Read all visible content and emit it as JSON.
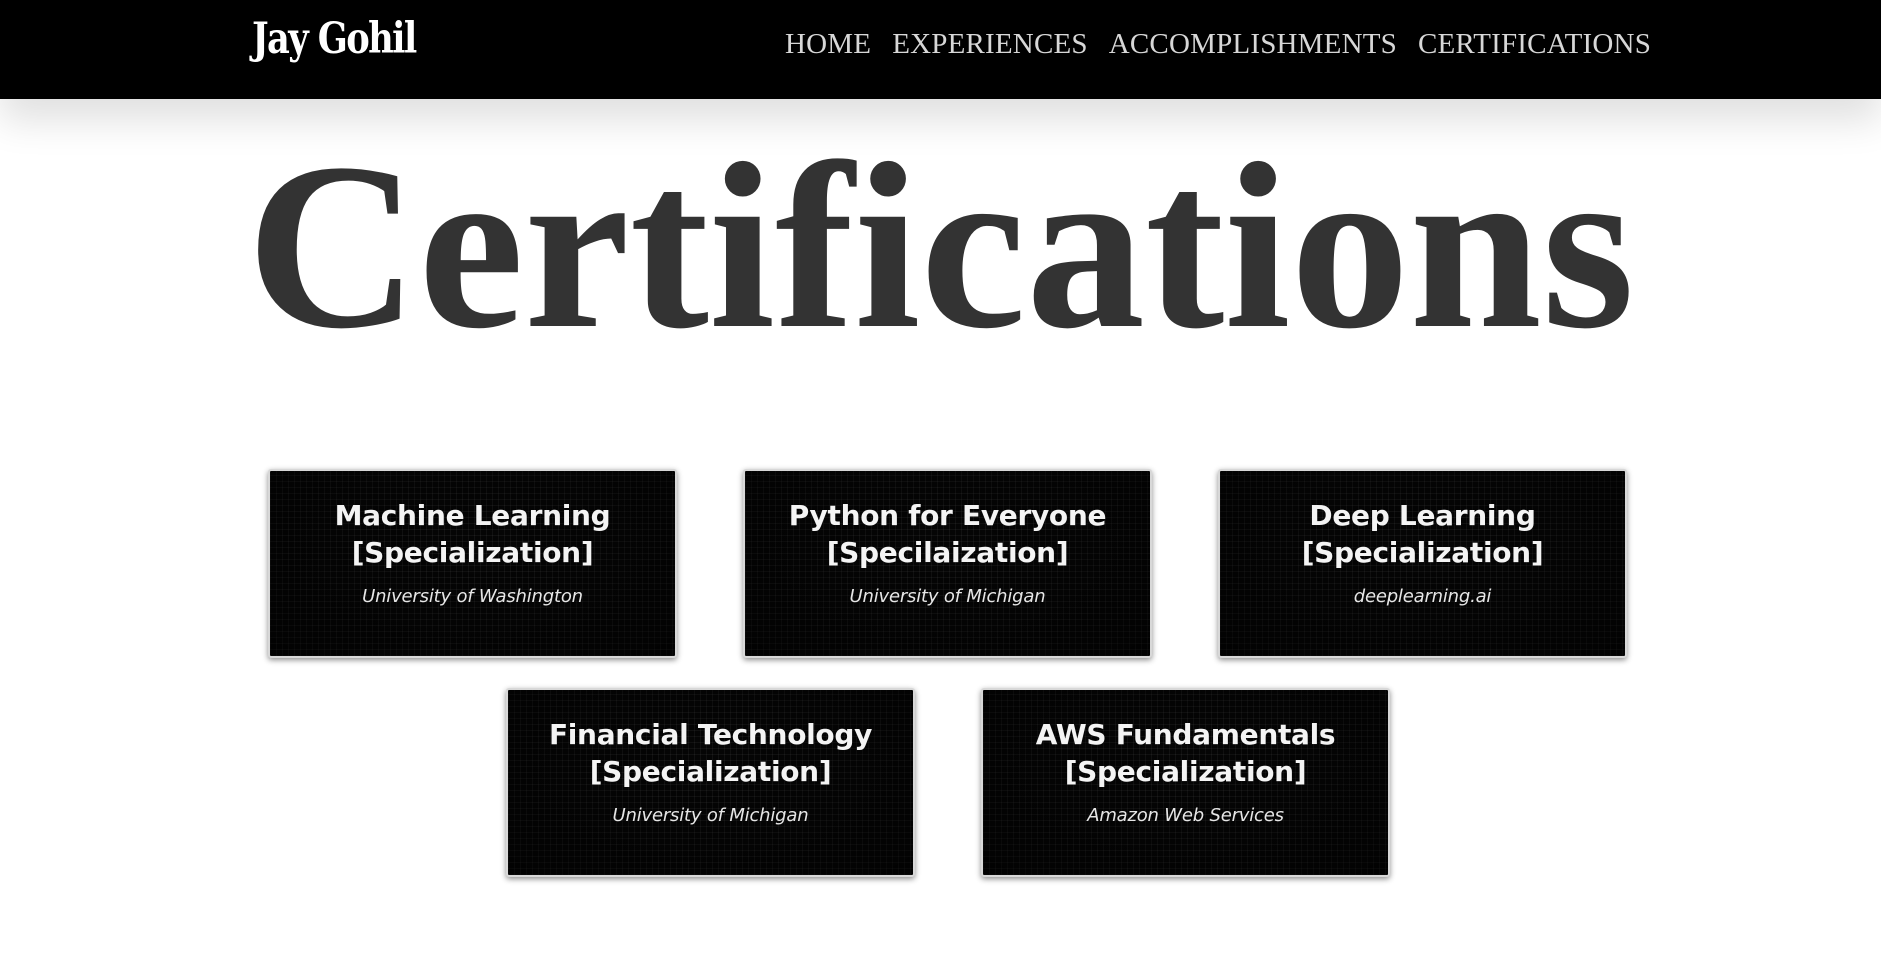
{
  "navbar": {
    "brand": "Jay Gohil",
    "links": [
      "HOME",
      "EXPERIENCES",
      "ACCOMPLISHMENTS",
      "CERTIFICATIONS"
    ]
  },
  "page": {
    "title": "Certifications"
  },
  "certifications": [
    {
      "title_line1": "Machine Learning",
      "title_line2": "[Specialization]",
      "org": "University of Washington"
    },
    {
      "title_line1": "Python for Everyone",
      "title_line2": "[Specilaization]",
      "org": "University of Michigan"
    },
    {
      "title_line1": "Deep Learning",
      "title_line2": "[Specialization]",
      "org": "deeplearning.ai"
    },
    {
      "title_line1": "Financial Technology",
      "title_line2": "[Specialization]",
      "org": "University of Michigan"
    },
    {
      "title_line1": "AWS Fundamentals",
      "title_line2": "[Specialization]",
      "org": "Amazon Web Services"
    }
  ],
  "colors": {
    "navbar_bg": "#000000",
    "nav_text": "#d7d7d7",
    "title_text": "#333333",
    "card_bg": "#050505",
    "card_text": "#f4f4f4"
  }
}
